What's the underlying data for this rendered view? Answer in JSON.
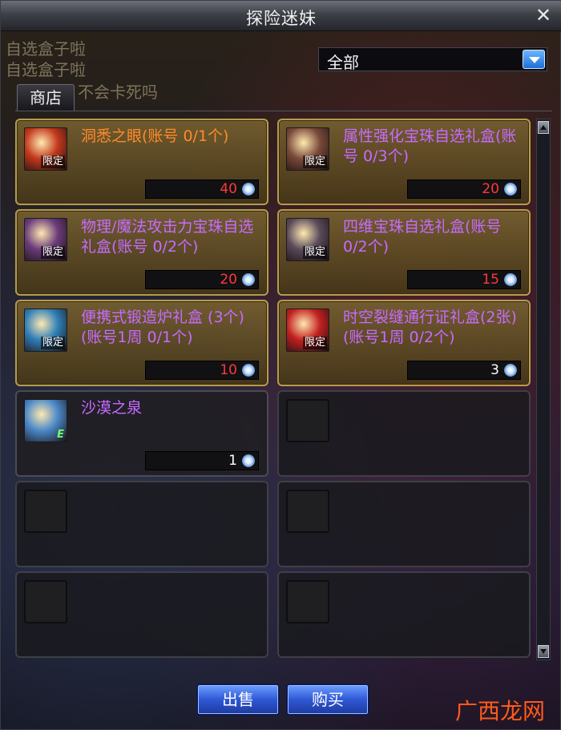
{
  "window": {
    "title": "探险迷妹"
  },
  "background_text": [
    "自选盒子啦",
    "自选盒子啦",
    "不会卡死吗"
  ],
  "filter": {
    "selected": "全部"
  },
  "tabs": [
    {
      "label": "商店"
    }
  ],
  "items": [
    {
      "name": "洞悉之眼",
      "limit": "(账号 0/1个)",
      "price": "40",
      "badge": "限定",
      "color": "orange",
      "icon": "gift-eye-icon",
      "icon_color": "#c2381c"
    },
    {
      "name": "属性强化宝珠自选礼盒",
      "limit": "(账号 0/3个)",
      "price": "20",
      "badge": "限定",
      "color": "purple",
      "icon": "treasure-chest-icon",
      "icon_color": "#7a4a3a"
    },
    {
      "name": "物理/魔法攻击力宝珠自选礼盒",
      "limit": "(账号 0/2个)",
      "price": "20",
      "badge": "限定",
      "color": "purple",
      "icon": "treasure-chest-icon",
      "icon_color": "#6a3c7a"
    },
    {
      "name": "四维宝珠自选礼盒",
      "limit": "(账号 0/2个)",
      "price": "15",
      "badge": "限定",
      "color": "purple",
      "icon": "treasure-chest-icon",
      "icon_color": "#5a4a5a"
    },
    {
      "name": "便携式锻造炉礼盒 (3个)",
      "limit": "(账号1周 0/1个)",
      "price": "10",
      "badge": "限定",
      "color": "purple",
      "icon": "forge-box-icon",
      "icon_color": "#2f7fb8"
    },
    {
      "name": "时空裂缝通行证礼盒(2张)",
      "limit": "(账号1周 0/2个)",
      "price": "3",
      "badge": "限定",
      "color": "purple",
      "icon": "pass-box-icon",
      "icon_color": "#c22020"
    },
    {
      "name": "沙漠之泉",
      "limit": "",
      "price": "1",
      "badge": "",
      "color": "purple",
      "icon": "potion-bottle-icon",
      "icon_color": "#4a88c8"
    }
  ],
  "buttons": {
    "sell": "出售",
    "buy": "购买"
  },
  "watermark": "广西龙网"
}
